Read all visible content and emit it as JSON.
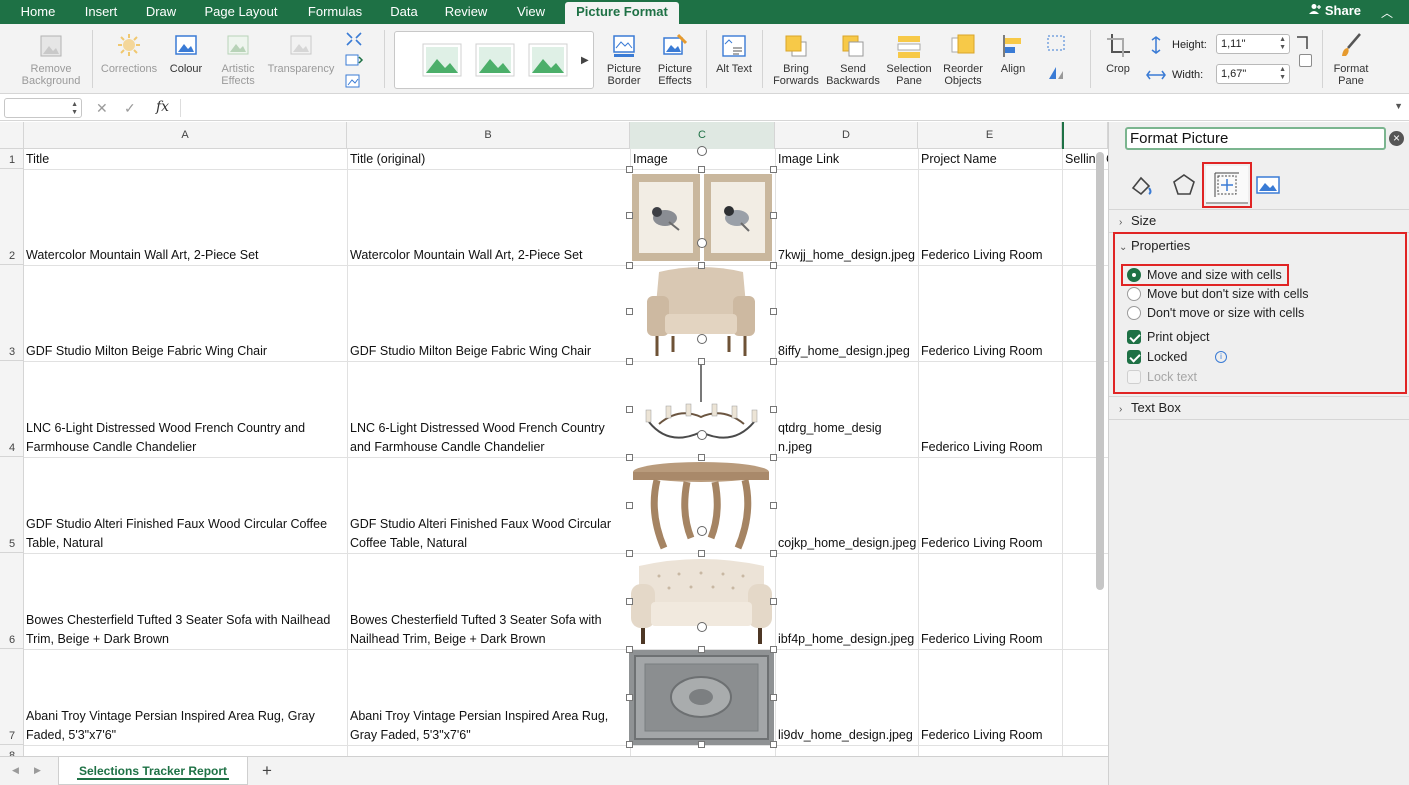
{
  "ribbon_tabs": [
    "Home",
    "Insert",
    "Draw",
    "Page Layout",
    "Formulas",
    "Data",
    "Review",
    "View",
    "Picture Format"
  ],
  "active_tab": "Picture Format",
  "share_label": "Share",
  "ribbon": {
    "remove_background": "Remove Background",
    "corrections": "Corrections",
    "colour": "Colour",
    "artistic_effects": "Artistic Effects",
    "transparency": "Transparency",
    "picture_border": "Picture Border",
    "picture_effects": "Picture Effects",
    "alt_text": "Alt Text",
    "bring_forwards": "Bring Forwards",
    "send_backwards": "Send Backwards",
    "selection_pane": "Selection Pane",
    "reorder_objects": "Reorder Objects",
    "align": "Align",
    "crop": "Crop",
    "height_label": "Height:",
    "height_value": "1,11\"",
    "width_label": "Width:",
    "width_value": "1,67\"",
    "format_pane": "Format Pane"
  },
  "formula_bar": {
    "fx": "fx",
    "cancel": "✕",
    "enter": "✓"
  },
  "columns": [
    "A",
    "B",
    "C",
    "D",
    "E"
  ],
  "headers": {
    "title": "Title",
    "title_original": "Title (original)",
    "image": "Image",
    "image_link": "Image Link",
    "project_name": "Project Name",
    "selling": "Selling C"
  },
  "rows": [
    {
      "num": "2",
      "title": "Watercolor Mountain Wall Art, 2-Piece Set",
      "title_original": "Watercolor Mountain Wall Art, 2-Piece Set",
      "image_link": "7kwjj_home_design.jpeg",
      "project": "Federico Living Room"
    },
    {
      "num": "3",
      "title": "GDF Studio Milton Beige Fabric Wing Chair",
      "title_original": "GDF Studio Milton Beige Fabric Wing Chair",
      "image_link": "8iffy_home_design.jpeg",
      "project": "Federico Living Room"
    },
    {
      "num": "4",
      "title": "LNC 6-Light Distressed Wood French Country and Farmhouse Candle Chandelier",
      "title_original": "LNC 6-Light Distressed Wood French Country and Farmhouse Candle Chandelier",
      "image_link": "qtdrg_home_design.jpeg",
      "project": "Federico Living Room"
    },
    {
      "num": "5",
      "title": "GDF Studio Alteri Finished Faux Wood Circular Coffee Table, Natural",
      "title_original": "GDF Studio Alteri Finished Faux Wood Circular Coffee Table, Natural",
      "image_link": "cojkp_home_design.jpeg",
      "project": "Federico Living Room"
    },
    {
      "num": "6",
      "title": "Bowes Chesterfield Tufted 3 Seater Sofa with Nailhead Trim, Beige + Dark Brown",
      "title_original": "Bowes Chesterfield Tufted 3 Seater Sofa with Nailhead Trim, Beige + Dark Brown",
      "image_link": "ibf4p_home_design.jpeg",
      "project": "Federico Living Room"
    },
    {
      "num": "7",
      "title": "Abani Troy Vintage Persian Inspired Area Rug, Gray Faded, 5'3\"x7'6\"",
      "title_original": "Abani Troy Vintage Persian Inspired Area Rug, Gray Faded, 5'3\"x7'6\"",
      "image_link": "li9dv_home_design.jpeg",
      "project": "Federico Living Room"
    }
  ],
  "row_numbers": {
    "r1": "1",
    "r8": "8"
  },
  "sheet_tab": "Selections Tracker Report",
  "add_sheet": "+",
  "pane": {
    "title": "Format Picture",
    "sections": {
      "size": "Size",
      "properties": "Properties",
      "text_box": "Text Box"
    },
    "options": {
      "move_and_size": "Move and size with cells",
      "move_not_size": "Move but don't size with cells",
      "dont_move": "Don't move or size with cells",
      "print_object": "Print object",
      "locked": "Locked",
      "lock_text": "Lock text"
    },
    "selected_option": "move_and_size",
    "print_object_checked": true,
    "locked_checked": true,
    "lock_text_enabled": false
  },
  "colors": {
    "accent": "#1e7145",
    "highlight": "#e02424"
  }
}
